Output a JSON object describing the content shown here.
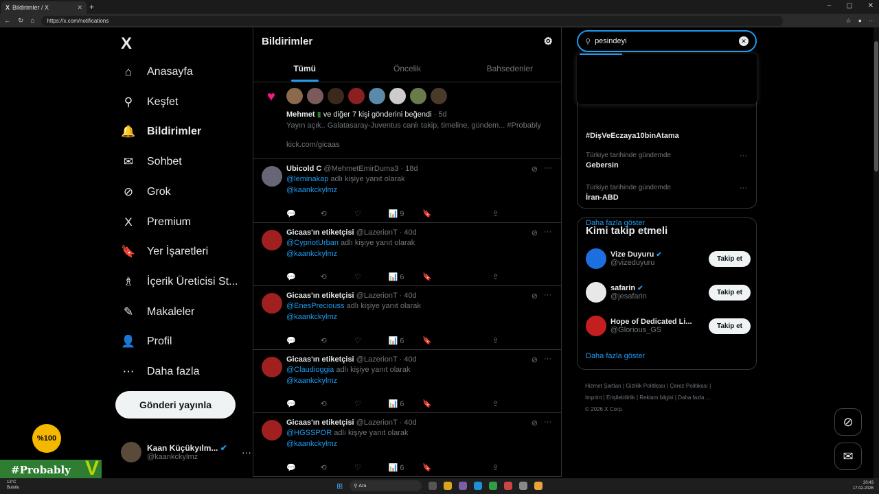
{
  "browser": {
    "tab_title": "Bildirimler / X",
    "tab_close": "✕",
    "new_tab": "+",
    "url": "https://x.com/notifications",
    "window_controls": [
      "–",
      "▢",
      "✕"
    ]
  },
  "sidebar": {
    "logo": "X",
    "items": [
      {
        "label": "Anasayfa",
        "icon": "home-icon",
        "glyph": "⌂"
      },
      {
        "label": "Keşfet",
        "icon": "search-icon",
        "glyph": "⚲"
      },
      {
        "label": "Bildirimler",
        "icon": "bell-icon",
        "glyph": "🔔"
      },
      {
        "label": "Sohbet",
        "icon": "mail-icon",
        "glyph": "✉"
      },
      {
        "label": "Grok",
        "icon": "grok-icon",
        "glyph": "⊘"
      },
      {
        "label": "Premium",
        "icon": "x-icon",
        "glyph": "X"
      },
      {
        "label": "Yer İşaretleri",
        "icon": "bookmark-icon",
        "glyph": "🔖"
      },
      {
        "label": "İçerik Üreticisi St...",
        "icon": "creator-icon",
        "glyph": "♗"
      },
      {
        "label": "Makaleler",
        "icon": "article-icon",
        "glyph": "✎"
      },
      {
        "label": "Profil",
        "icon": "profile-icon",
        "glyph": "👤"
      },
      {
        "label": "Daha fazla",
        "icon": "more-circle-icon",
        "glyph": "⋯"
      }
    ],
    "post_button": "Gönderi yayınla",
    "user": {
      "name": "Kaan Küçükyılm...",
      "handle": "@kaankckylmz",
      "more": "···"
    }
  },
  "center": {
    "title": "Bildirimler",
    "tabs": [
      "Tümü",
      "Öncelik",
      "Bahsedenler"
    ],
    "like_notification": {
      "actor": "Mehmet",
      "text": "ve diğer 7 kişi gönderini beğendi",
      "time": "· 5d",
      "preview": "Yayın açık.. Galatasaray-Juventus canlı takip, timeline, gündem... #Probably",
      "link": "kick.com/gicaas"
    },
    "posts": [
      {
        "name": "Ubicold C",
        "handle": "@MehmetEmirDuma3",
        "time": "· 18d",
        "reply_to": "@leminakap",
        "reply_suffix": "adlı kişiye yanıt olarak",
        "mention": "@kaankckylmz",
        "views": "9"
      },
      {
        "name": "Gicaas'ın etiketçisi",
        "handle": "@LazerionT",
        "time": "· 40d",
        "reply_to": "@CypriotUrban",
        "reply_suffix": "adlı kişiye yanıt olarak",
        "mention": "@kaankckylmz",
        "views": "6"
      },
      {
        "name": "Gicaas'ın etiketçisi",
        "handle": "@LazerionT",
        "time": "· 40d",
        "reply_to": "@EnesPreciouss",
        "reply_suffix": "adlı kişiye yanıt olarak",
        "mention": "@kaankckylmz",
        "views": "6"
      },
      {
        "name": "Gicaas'ın etiketçisi",
        "handle": "@LazerionT",
        "time": "· 40d",
        "reply_to": "@Claudioggia",
        "reply_suffix": "adlı kişiye yanıt olarak",
        "mention": "@kaankckylmz",
        "views": "6"
      },
      {
        "name": "Gicaas'ın etiketçisi",
        "handle": "@LazerionT",
        "time": "· 40d",
        "reply_to": "@HGSSPOR",
        "reply_suffix": "adlı kişiye yanıt olarak",
        "mention": "@kaankckylmz",
        "views": "6"
      }
    ]
  },
  "right": {
    "search_value": "pesindeyi",
    "trends": [
      {
        "meta": "",
        "name": "#DişVeEczaya10binAtama"
      },
      {
        "meta": "Türkiye tarihinde gündemde",
        "name": "Gebersin"
      },
      {
        "meta": "Türkiye tarihinde gündemde",
        "name": "İran-ABD"
      }
    ],
    "trends_more": "Daha fazla göster",
    "who_to_follow": {
      "title": "Kimi takip etmeli",
      "accounts": [
        {
          "name": "Vize Duyuru",
          "handle": "@vizeduyuru",
          "button": "Takip et",
          "color": "#1d6fe0"
        },
        {
          "name": "safarin",
          "handle": "@jesafarin",
          "button": "Takip et",
          "color": "#e8e8e8"
        },
        {
          "name": "Hope of Dedicated Li...",
          "handle": "@Glorious_GS",
          "button": "Takip et",
          "color": "#c41e1e"
        }
      ],
      "more": "Daha fazla göster"
    },
    "footer": [
      "Hizmet Şartları",
      "Gizlilik Politikası",
      "Çerez Politikası",
      "Imprint",
      "Erişilebilirlik",
      "Reklam bilgisi",
      "Daha fazla ...",
      "© 2026 X Corp."
    ]
  },
  "overlay": {
    "badge": "%100",
    "brand": "#Probably"
  },
  "taskbar": {
    "weather_temp": "13°C",
    "weather_text": "Bulutlu",
    "search": "Ara",
    "time": "20:43",
    "date": "17.02.2026"
  }
}
